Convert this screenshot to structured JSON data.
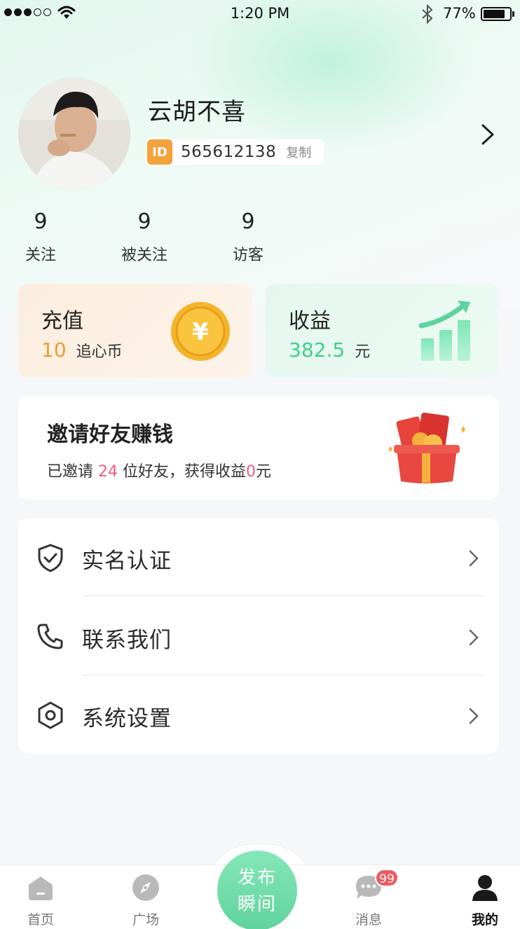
{
  "status_bar": {
    "time": "1:20 PM",
    "battery": "77%"
  },
  "profile": {
    "name": "云胡不喜",
    "id_badge": "ID",
    "id_number": "565612138",
    "copy_label": "复制"
  },
  "stats": [
    {
      "value": "9",
      "label": "关注"
    },
    {
      "value": "9",
      "label": "被关注"
    },
    {
      "value": "9",
      "label": "访客"
    }
  ],
  "recharge": {
    "title": "充值",
    "value": "10",
    "unit": "追心币",
    "coin_symbol": "¥"
  },
  "income": {
    "title": "收益",
    "value": "382.5",
    "unit": "元"
  },
  "invite": {
    "title": "邀请好友赚钱",
    "prefix": "已邀请",
    "count": "24",
    "middle": "位好友，获得收益",
    "earnings": "0",
    "suffix": "元"
  },
  "menu": [
    {
      "label": "实名认证",
      "icon": "shield-check-icon"
    },
    {
      "label": "联系我们",
      "icon": "phone-icon"
    },
    {
      "label": "系统设置",
      "icon": "hexagon-settings-icon"
    }
  ],
  "tabbar": {
    "tabs": [
      {
        "label": "首页",
        "icon": "home-icon"
      },
      {
        "label": "广场",
        "icon": "compass-icon"
      },
      {
        "label": "消息",
        "icon": "chat-icon",
        "badge": "99"
      },
      {
        "label": "我的",
        "icon": "user-icon",
        "active": true
      }
    ],
    "publish_line1": "发布",
    "publish_line2": "瞬间"
  },
  "colors": {
    "accent_green": "#5fd39d",
    "orange": "#f09a34",
    "pink": "#ef5a82",
    "badge_red": "#ee5a60"
  }
}
